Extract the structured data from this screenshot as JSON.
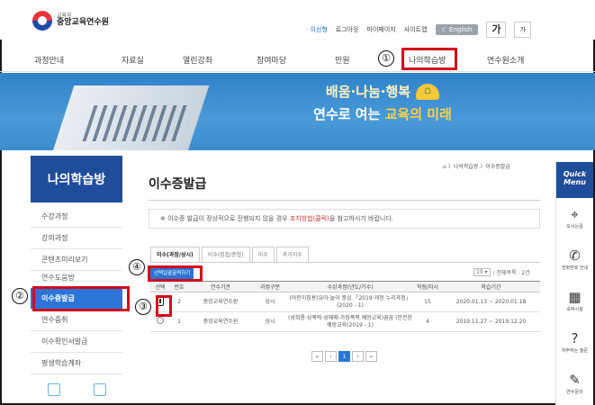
{
  "header": {
    "logo_sub": "교육부",
    "logo_main": "중앙교육연수원",
    "util": [
      "이선형",
      "로그아웃",
      "마이페이지",
      "사이트맵"
    ],
    "english_btn": "English",
    "font_large": "가",
    "font_small": "가"
  },
  "gnb": [
    "과정안내",
    "자료실",
    "열린강좌",
    "참여마당",
    "민원",
    "나의학습방",
    "연수원소개"
  ],
  "banner": {
    "line1": "배움·나눔·행복",
    "line2_a": "연수로 여는 ",
    "line2_b": "교육의 미래"
  },
  "lnb": {
    "title": "나의학습방",
    "items": [
      "수강과정",
      "강의과정",
      "콘텐츠미리보기",
      "연수도움방",
      "이수증발급",
      "연수중취",
      "이수확인서발급",
      "평생학습계좌"
    ]
  },
  "main": {
    "title": "이수증발급",
    "breadcrumb": "⌂ 〉나의학습방 〉이수증발급",
    "notice_prefix": "※ 이수증 발급이 정상적으로 진행되지 않을 경우 ",
    "notice_link": "조치방법(클릭)",
    "notice_suffix": "을 참고하시기 바랍니다.",
    "tabs": [
      "이수(과정/상시)",
      "이수(집합/종합)",
      "이수",
      "과거이수"
    ],
    "print_button": "선택일괄출력하기",
    "pager_size": "10",
    "pager_total": "/ 전체목록 : 2건",
    "table_headers": [
      "선택",
      "번호",
      "연수기관",
      "과정구분",
      "수강과정(년도/기수)",
      "학점/차시",
      "학습기간"
    ],
    "rows": [
      {
        "no": "2",
        "org": "중앙교육연수원",
        "type": "상시",
        "course": "(어린이집용)유아·놀이 중심 「2019 개정 누리과정」(2020 - 1)",
        "credit": "15",
        "period": "2020.01.13 ~ 2020.01.18"
      },
      {
        "no": "1",
        "org": "중앙교육연수원",
        "type": "상시",
        "course": "(성희롱·성폭력·성매매·가정폭력 예방교육)꿈꿈 (안전한 예방교육(2019 - 1)",
        "credit": "4",
        "period": "2019.11.27 ~ 2019.12.20"
      }
    ],
    "paging": [
      "«",
      "‹",
      "1",
      "›",
      "»"
    ]
  },
  "quick": {
    "title_1": "Quick",
    "title_2": "Menu",
    "items": [
      {
        "icon": "map-pin-icon",
        "glyph": "⌖",
        "label": "오시는길"
      },
      {
        "icon": "phone-icon",
        "glyph": "✆",
        "label": "전화번호 안내"
      },
      {
        "icon": "building-icon",
        "glyph": "▦",
        "label": "숙박시설"
      },
      {
        "icon": "faq-icon",
        "glyph": "?",
        "label": "자주하는 질문"
      },
      {
        "icon": "inquiry-icon",
        "glyph": "✎",
        "label": "연수문의"
      }
    ]
  },
  "annotations": [
    "①",
    "②",
    "③",
    "④"
  ],
  "colors": {
    "primary": "#1f4d9b",
    "accent": "#2a75d6",
    "highlight": "#d4091c",
    "banner": "#3c8ccf"
  }
}
